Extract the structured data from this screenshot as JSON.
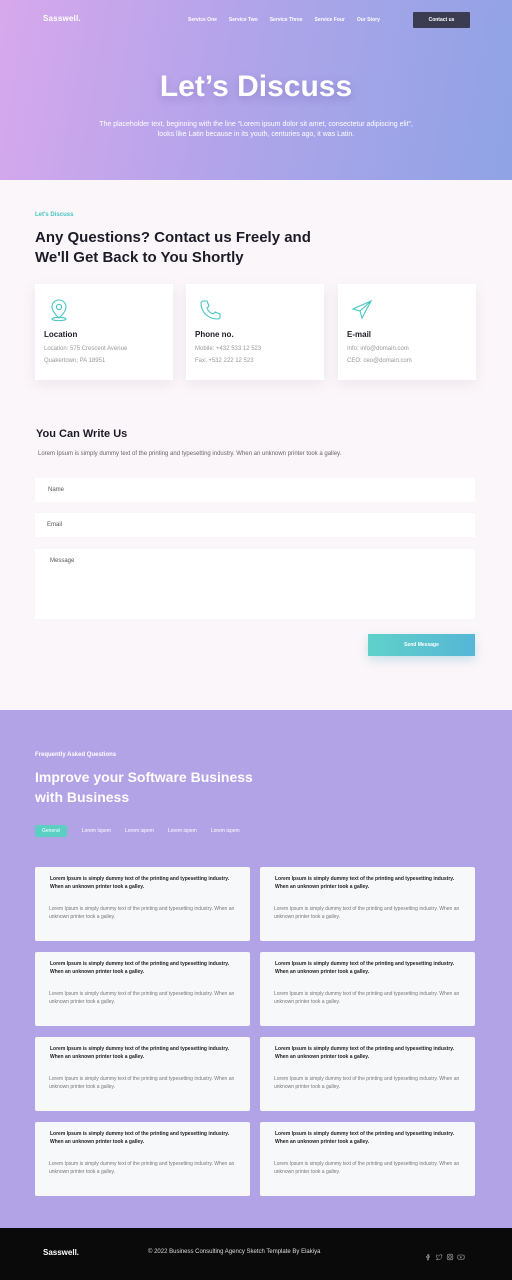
{
  "header": {
    "logo": "Sasswell.",
    "nav": [
      "Service One",
      "Service Two",
      "Service Three",
      "Service Four",
      "Our Story"
    ],
    "cta": "Contact us"
  },
  "hero": {
    "title": "Let’s Discuss",
    "subtitle": "The placeholder text, beginning with the line “Lorem ipsum dolor sit amet, consectetur adipiscing elit”, looks like Latin because in its youth, centuries ago, it was Latin."
  },
  "contact": {
    "eyebrow": "Let's Discuss",
    "heading": "Any Questions? Contact us Freely and We'll Get Back to You Shortly",
    "cards": [
      {
        "icon": "location-pin-icon",
        "title": "Location",
        "line1": "Location: 575 Crescent Avenue",
        "line2": "Quakertown, PA 18951"
      },
      {
        "icon": "phone-icon",
        "title": "Phone no.",
        "line1": "Mobile: +432 533 12 523",
        "line2": "Fax: +532 222 12 523"
      },
      {
        "icon": "paper-plane-icon",
        "title": "E-mail",
        "line1": "Info: info@domain.com",
        "line2": "CEO: ceo@domain.com"
      }
    ],
    "accent": "#46c6c2"
  },
  "form": {
    "title": "You Can Write Us",
    "description": "Lorem Ipsum is simply dummy text of the printing and typesetting industry. When an unknown printer took a galley.",
    "name_placeholder": "Name",
    "email_placeholder": "Email",
    "message_placeholder": "Message",
    "submit": "Send Message"
  },
  "faq": {
    "eyebrow": "Frequently Asked Questions",
    "heading": "Improve your Software Business with Business",
    "tabs": [
      "General",
      "Lorem Ispem",
      "Lorem ispem",
      "Lorem ispem",
      "Lorem ispem"
    ],
    "items": [
      {
        "q": "Lorem Ipsum is simply dummy text of the printing and typesetting industry. When an unknown printer took a galley.",
        "a": "Lorem Ipsum is simply dummy text of the printing and typesetting industry. When an unknown printer took a galley."
      },
      {
        "q": "Lorem Ipsum is simply dummy text of the printing and typesetting industry. When an unknown printer took a galley.",
        "a": "Lorem Ipsum is simply dummy text of the printing and typesetting industry. When an unknown printer took a galley."
      },
      {
        "q": "Lorem Ipsum is simply dummy text of the printing and typesetting industry. When an unknown printer took a galley.",
        "a": "Lorem Ipsum is simply dummy text of the printing and typesetting industry. When an unknown printer took a galley."
      },
      {
        "q": "Lorem Ipsum is simply dummy text of the printing and typesetting industry. When an unknown printer took a galley.",
        "a": "Lorem Ipsum is simply dummy text of the printing and typesetting industry. When an unknown printer took a galley."
      },
      {
        "q": "Lorem Ipsum is simply dummy text of the printing and typesetting industry. When an unknown printer took a galley.",
        "a": "Lorem Ipsum is simply dummy text of the printing and typesetting industry. When an unknown printer took a galley."
      },
      {
        "q": "Lorem Ipsum is simply dummy text of the printing and typesetting industry. When an unknown printer took a galley.",
        "a": "Lorem Ipsum is simply dummy text of the printing and typesetting industry. When an unknown printer took a galley."
      },
      {
        "q": "Lorem Ipsum is simply dummy text of the printing and typesetting industry. When an unknown printer took a galley.",
        "a": "Lorem Ipsum is simply dummy text of the printing and typesetting industry. When an unknown printer took a galley."
      },
      {
        "q": "Lorem Ipsum is simply dummy text of the printing and typesetting industry. When an unknown printer took a galley.",
        "a": "Lorem Ipsum is simply dummy text of the printing and typesetting industry. When an unknown printer took a galley."
      }
    ]
  },
  "footer": {
    "logo": "Sasswell.",
    "copyright": "© 2022 Business Consulting Agency Sketch Template By Elakiya",
    "social": [
      "facebook-icon",
      "twitter-icon",
      "instagram-icon",
      "youtube-icon"
    ]
  }
}
